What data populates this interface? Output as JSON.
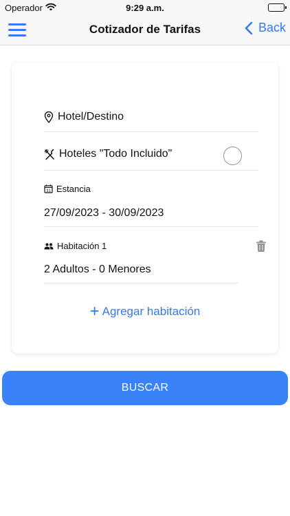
{
  "status_bar": {
    "carrier": "Operador",
    "time": "9:29 a.m.",
    "battery_level": 1.0
  },
  "nav": {
    "title": "Cotizador de Tarifas",
    "back_label": "Back"
  },
  "form": {
    "hotel_destination_placeholder": "Hotel/Destino",
    "all_inclusive_label": "Hoteles \"Todo Incluido\"",
    "all_inclusive_checked": false,
    "stay_label": "Estancia",
    "calendar_day_glyph": "31",
    "stay_dates": "27/09/2023 - 30/09/2023",
    "rooms": [
      {
        "label": "Habitación 1",
        "guests": "2 Adultos - 0 Menores"
      }
    ],
    "add_room_label": "Agregar habitación"
  },
  "search_button_label": "BUSCAR",
  "colors": {
    "accent": "#3478f6",
    "button": "#3a82f7",
    "bar_background": "#f7f7f7"
  },
  "icons": [
    "wifi-icon",
    "battery-icon",
    "menu-icon",
    "chevron-left-icon",
    "location-pin-icon",
    "fork-knife-icon",
    "calendar-icon",
    "people-icon",
    "trash-icon",
    "plus-icon"
  ]
}
